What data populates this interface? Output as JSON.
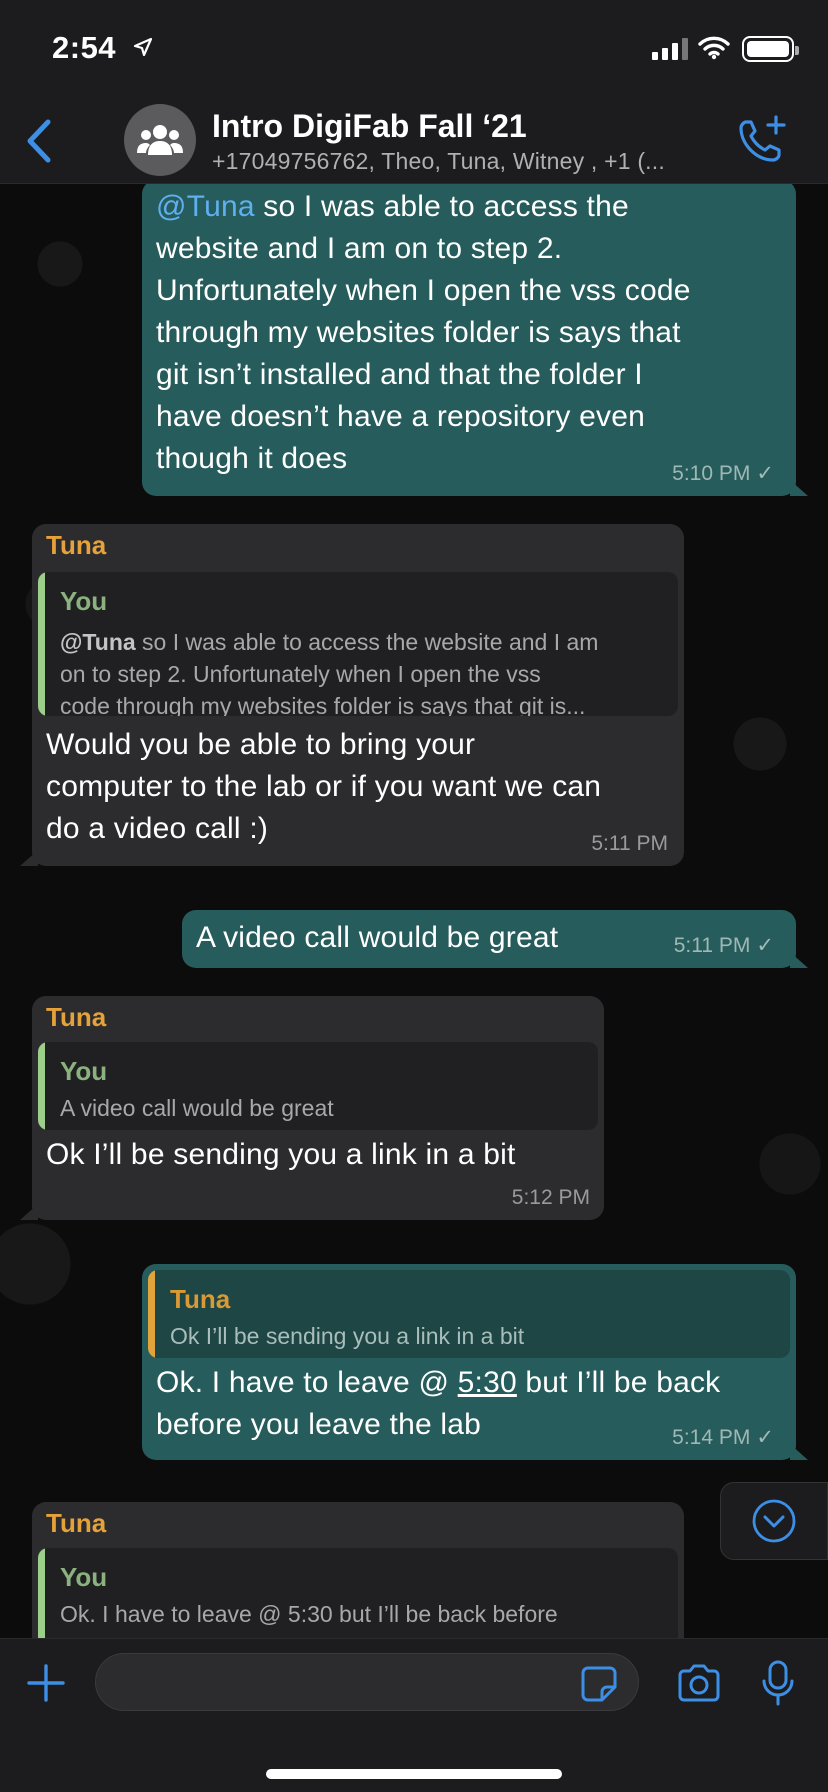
{
  "status_bar": {
    "time": "2:54",
    "icons": [
      "location-arrow-icon",
      "cellular-signal-icon",
      "wifi-icon",
      "battery-icon"
    ]
  },
  "header": {
    "title": "Intro DigiFab Fall ‘21",
    "subtitle": "+17049756762, Theo, Tuna, Witney , +1 (...",
    "icons": [
      "back-chevron-icon",
      "group-avatar-icon",
      "add-call-icon"
    ]
  },
  "colors": {
    "accent_blue": "#3d8fe5",
    "outgoing_bubble": "#265c5b",
    "incoming_bubble": "#2c2c2e",
    "sender_name": "#e6a23a",
    "you_quote_name": "#8bb27e",
    "you_quote_bar": "#9ccf8a",
    "tuna_quote_bar": "#e0a43a"
  },
  "messages": [
    {
      "direction": "outgoing",
      "mention": "@Tuna",
      "lines": [
        " so I was able to access the",
        "website and I am on to step 2.",
        "Unfortunately when I open the vss code",
        "through my websites folder is says that",
        "git isn’t installed and that the folder I",
        "have doesn’t have a repository even",
        "though it does"
      ],
      "time": "5:10 PM",
      "status": "✓"
    },
    {
      "direction": "incoming",
      "sender": "Tuna",
      "quote": {
        "name": "You",
        "mention": "@Tuna",
        "lines": [
          " so I was able to access the website and I am",
          "on to step 2. Unfortunately when I open the vss",
          "code through my websites folder is says that git is..."
        ]
      },
      "lines": [
        "Would you be able to bring your",
        "computer to the lab or if you want we can",
        "do a video call :)"
      ],
      "time": "5:11 PM"
    },
    {
      "direction": "outgoing",
      "text": "A video call would be great",
      "time": "5:11 PM",
      "status": "✓"
    },
    {
      "direction": "incoming",
      "sender": "Tuna",
      "quote": {
        "name": "You",
        "text": "A video call would be great"
      },
      "text": "Ok I’ll be sending you a link in a bit",
      "time": "5:12 PM"
    },
    {
      "direction": "outgoing",
      "quote": {
        "name": "Tuna",
        "text": "Ok I’ll be sending you a link in a bit"
      },
      "line1_before": "Ok. I have to leave @ ",
      "line1_link": "5:30",
      "line1_after": " but I’ll be back",
      "line2": "before you leave the lab",
      "time": "5:14 PM",
      "status": "✓"
    },
    {
      "direction": "incoming",
      "sender": "Tuna",
      "quote": {
        "name": "You",
        "text": "Ok. I have to leave @ 5:30 but I’ll be back before"
      }
    }
  ],
  "input": {
    "value": "",
    "placeholder": "",
    "icons": [
      "plus-icon",
      "sticker-icon",
      "camera-icon",
      "microphone-icon",
      "scroll-down-icon"
    ]
  }
}
